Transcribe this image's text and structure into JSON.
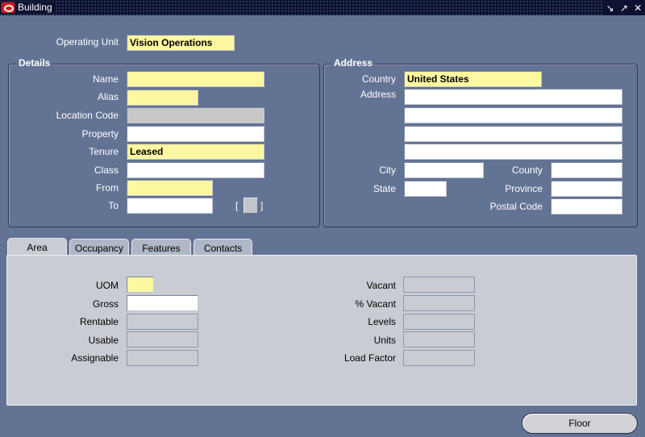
{
  "window": {
    "title": "Building",
    "controls": [
      "↘",
      "↗",
      "✕"
    ]
  },
  "header": {
    "operating_unit_label": "Operating Unit",
    "operating_unit_value": "Vision Operations"
  },
  "details": {
    "title": "Details",
    "name_label": "Name",
    "name_value": "",
    "alias_label": "Alias",
    "alias_value": "",
    "location_code_label": "Location Code",
    "location_code_value": "",
    "property_label": "Property",
    "property_value": "",
    "tenure_label": "Tenure",
    "tenure_value": "Leased",
    "class_label": "Class",
    "class_value": "",
    "from_label": "From",
    "from_value": "",
    "to_label": "To",
    "to_value": "",
    "bracket_open": "[",
    "bracket_close": "]"
  },
  "address": {
    "title": "Address",
    "country_label": "Country",
    "country_value": "United States",
    "address_label": "Address",
    "address_lines": [
      "",
      "",
      "",
      ""
    ],
    "city_label": "City",
    "city_value": "",
    "county_label": "County",
    "county_value": "",
    "state_label": "State",
    "state_value": "",
    "province_label": "Province",
    "province_value": "",
    "postal_code_label": "Postal Code",
    "postal_code_value": ""
  },
  "tabs": [
    {
      "label": "Area"
    },
    {
      "label": "Occupancy"
    },
    {
      "label": "Features"
    },
    {
      "label": "Contacts"
    }
  ],
  "area": {
    "uom_label": "UOM",
    "uom_value": "",
    "gross_label": "Gross",
    "gross_value": "",
    "rentable_label": "Rentable",
    "rentable_value": "",
    "usable_label": "Usable",
    "usable_value": "",
    "assignable_label": "Assignable",
    "assignable_value": "",
    "vacant_label": "Vacant",
    "vacant_value": "",
    "pct_vacant_label": "% Vacant",
    "pct_vacant_value": "",
    "levels_label": "Levels",
    "levels_value": "",
    "units_label": "Units",
    "units_value": "",
    "load_factor_label": "Load Factor",
    "load_factor_value": ""
  },
  "buttons": {
    "floor_label": "Floor"
  },
  "colors": {
    "background": "#637394",
    "required_field": "#fdf7a1",
    "title_bar": "#0c1230",
    "tab_panel": "#c9ccd3"
  }
}
